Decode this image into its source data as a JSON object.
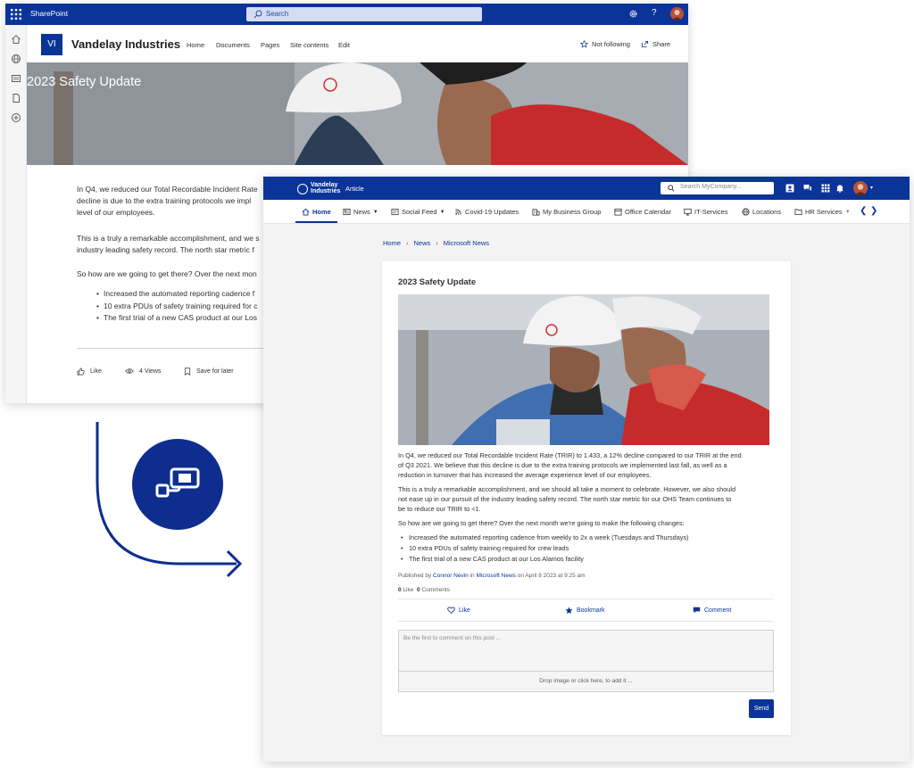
{
  "sharepoint": {
    "app_name": "SharePoint",
    "search_placeholder": "Search",
    "help_label": "?",
    "site_logo_initials": "VI",
    "site_title": "Vandelay Industries",
    "nav": [
      "Home",
      "Documents",
      "Pages",
      "Site contents",
      "Edit"
    ],
    "follow_label": "Not following",
    "share_label": "Share",
    "hero_title": "2023 Safety Update",
    "body": {
      "p1_line1": "In Q4, we reduced our Total Recordable Incident Rate",
      "p1_line2": "decline is due to the extra training protocols we impl",
      "p1_line3": "level of our employees.",
      "p2_line1": "This is a truly a remarkable accomplishment, and we s",
      "p2_line2": "industry leading safety record. The north star metric f",
      "p3": "So how are we going to get there? Over the next mon",
      "bullets": [
        "Increased the automated reporting cadence f",
        "10 extra PDUs of safety training required for c",
        "The first trial of a new CAS product at our Los"
      ]
    },
    "actions": {
      "like": "Like",
      "views": "4 Views",
      "save": "Save for later"
    }
  },
  "intranet": {
    "logo_text_1": "Vandelay",
    "logo_text_2": "Industries",
    "page_type": "Article",
    "search_placeholder": "Search MyCompany...",
    "nav": [
      {
        "label": "Home",
        "dropdown": false
      },
      {
        "label": "News",
        "dropdown": true
      },
      {
        "label": "Social Feed",
        "dropdown": true
      },
      {
        "label": "Covid-19 Updates",
        "dropdown": false
      },
      {
        "label": "My Business Group",
        "dropdown": false
      },
      {
        "label": "Office Calendar",
        "dropdown": false
      },
      {
        "label": "IT-Services",
        "dropdown": false
      },
      {
        "label": "Locations",
        "dropdown": false
      },
      {
        "label": "HR Services",
        "dropdown": true
      }
    ],
    "breadcrumb": [
      "Home",
      "News",
      "Microsoft News"
    ],
    "article": {
      "title": "2023 Safety Update",
      "p1": [
        "In Q4, we reduced our Total Recordable Incident Rate (TRIR) to 1.433, a 12% decline compared to our TRIR at the end",
        "of Q3 2021. We believe that this decline is due to the extra training protocols we implemented last fall, as well as a",
        "reduction in turnover that has increased the average experience level of our employees."
      ],
      "p2": [
        "This is a truly a remarkable accomplishment, and we should all take a moment to celebrate. However, we also should",
        "not ease up in our pursuit of the industry leading safety record. The north star metric for our OHS Team continues to",
        "be to reduce our TRIR to <1."
      ],
      "p3": "So how are we going to get there? Over the next month we're going to make the following changes:",
      "bullets": [
        "Increased the automated reporting cadence from weekly to 2x a week (Tuesdays and Thursdays)",
        "10 extra PDUs of safety training required for crew leads",
        "The first trial of a new CAS product at our Los Alamos facility"
      ],
      "published_prefix": "Published by",
      "author": "Connor Nevin",
      "in_word": "in",
      "channel": "Microsoft News",
      "date_text": "on April 8 2023 at 9:25 am",
      "likes_count": "0",
      "likes_label": "Like",
      "comments_count": "0",
      "comments_label": "Comments",
      "like_action": "Like",
      "bookmark_action": "Bookmark",
      "comment_action": "Comment",
      "comment_placeholder": "Be the first to comment on this post ...",
      "drop_label": "Drop image or click here, to add it ...",
      "send_label": "Send"
    }
  },
  "colors": {
    "brand_blue": "#0a3497",
    "flow_blue": "#0e2d8e"
  }
}
